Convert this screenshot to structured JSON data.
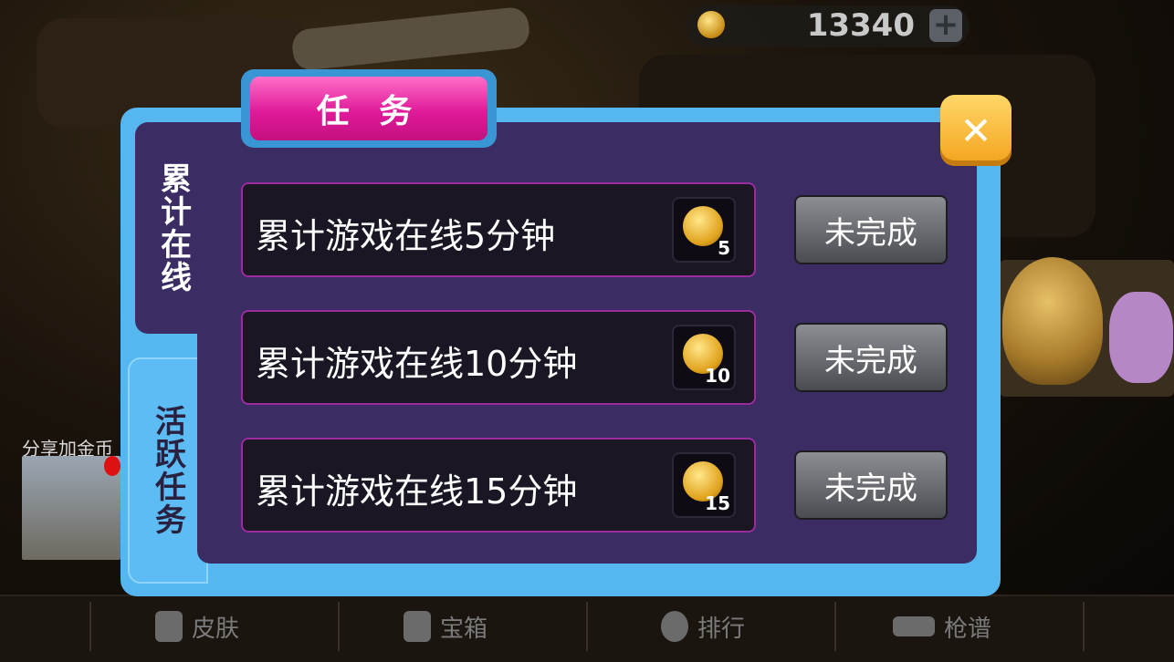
{
  "header": {
    "coin_count": "13340",
    "plus_label": "+"
  },
  "share": {
    "label": "分享加金币"
  },
  "dialog": {
    "title": "任 务",
    "close_label": "✕",
    "tabs": [
      {
        "label": "累计在线",
        "active": true
      },
      {
        "label": "活跃任务",
        "active": false
      }
    ],
    "tasks": [
      {
        "text": "累计游戏在线5分钟",
        "reward": "5",
        "status": "未完成"
      },
      {
        "text": "累计游戏在线10分钟",
        "reward": "10",
        "status": "未完成"
      },
      {
        "text": "累计游戏在线15分钟",
        "reward": "15",
        "status": "未完成"
      }
    ]
  },
  "bottom_nav": [
    {
      "label": "皮肤",
      "icon": "jacket-icon"
    },
    {
      "label": "宝箱",
      "icon": "people-icon"
    },
    {
      "label": "排行",
      "icon": "medal-icon"
    },
    {
      "label": "枪谱",
      "icon": "gun-icon"
    }
  ],
  "colors": {
    "panel_border": "#56b6ef",
    "panel_fill": "#3b2d63",
    "title_pink": "#e01a9a",
    "close_yellow": "#f3a31b",
    "row_border": "#9a2d9b"
  }
}
